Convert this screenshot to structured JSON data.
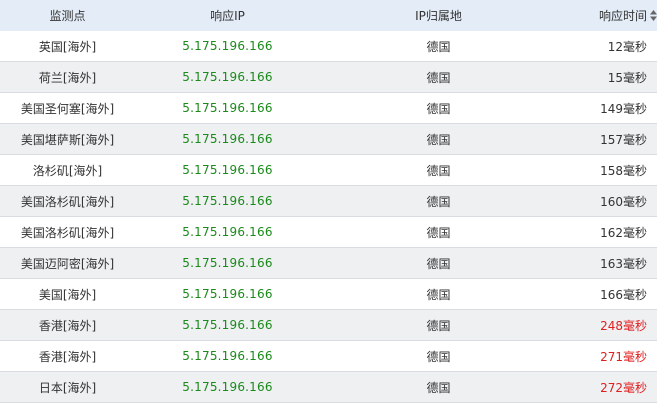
{
  "header": {
    "node": "监测点",
    "ip": "响应IP",
    "location": "IP归属地",
    "time": "响应时间"
  },
  "colors": {
    "header_bg": "#e3ecf7",
    "row_even_bg": "#eef0f2",
    "ip_text": "#1a8a1a",
    "slow_text": "#e02020"
  },
  "rows": [
    {
      "node": "英国[海外]",
      "ip": "5.175.196.166",
      "location": "德国",
      "time": "12毫秒",
      "slow": false
    },
    {
      "node": "荷兰[海外]",
      "ip": "5.175.196.166",
      "location": "德国",
      "time": "15毫秒",
      "slow": false
    },
    {
      "node": "美国圣何塞[海外]",
      "ip": "5.175.196.166",
      "location": "德国",
      "time": "149毫秒",
      "slow": false
    },
    {
      "node": "美国堪萨斯[海外]",
      "ip": "5.175.196.166",
      "location": "德国",
      "time": "157毫秒",
      "slow": false
    },
    {
      "node": "洛杉矶[海外]",
      "ip": "5.175.196.166",
      "location": "德国",
      "time": "158毫秒",
      "slow": false
    },
    {
      "node": "美国洛杉矶[海外]",
      "ip": "5.175.196.166",
      "location": "德国",
      "time": "160毫秒",
      "slow": false
    },
    {
      "node": "美国洛杉矶[海外]",
      "ip": "5.175.196.166",
      "location": "德国",
      "time": "162毫秒",
      "slow": false
    },
    {
      "node": "美国迈阿密[海外]",
      "ip": "5.175.196.166",
      "location": "德国",
      "time": "163毫秒",
      "slow": false
    },
    {
      "node": "美国[海外]",
      "ip": "5.175.196.166",
      "location": "德国",
      "time": "166毫秒",
      "slow": false
    },
    {
      "node": "香港[海外]",
      "ip": "5.175.196.166",
      "location": "德国",
      "time": "248毫秒",
      "slow": true
    },
    {
      "node": "香港[海外]",
      "ip": "5.175.196.166",
      "location": "德国",
      "time": "271毫秒",
      "slow": true
    },
    {
      "node": "日本[海外]",
      "ip": "5.175.196.166",
      "location": "德国",
      "time": "272毫秒",
      "slow": true
    }
  ]
}
